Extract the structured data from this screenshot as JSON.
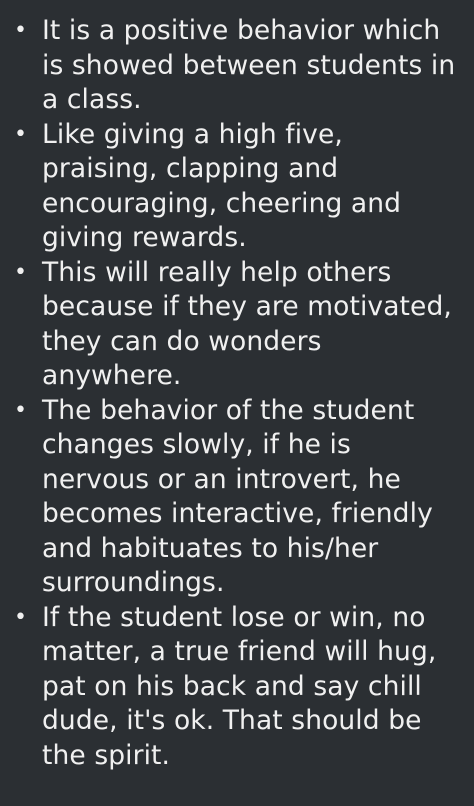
{
  "bullet_symbol": "•",
  "items": [
    {
      "text": "It is a positive behavior which is showed between students in a class."
    },
    {
      "text": "Like giving a high five, praising, clapping and encouraging, cheering and giving rewards."
    },
    {
      "text": "This will really help others because if they are motivated, they can do wonders anywhere."
    },
    {
      "text": "The behavior of the student changes slowly, if he is nervous or an introvert, he becomes interactive, friendly and habituates to his/her surroundings."
    },
    {
      "text": "If the student lose or win, no matter, a true friend will hug, pat on his back and say chill dude, it's ok. That should be the spirit."
    }
  ]
}
